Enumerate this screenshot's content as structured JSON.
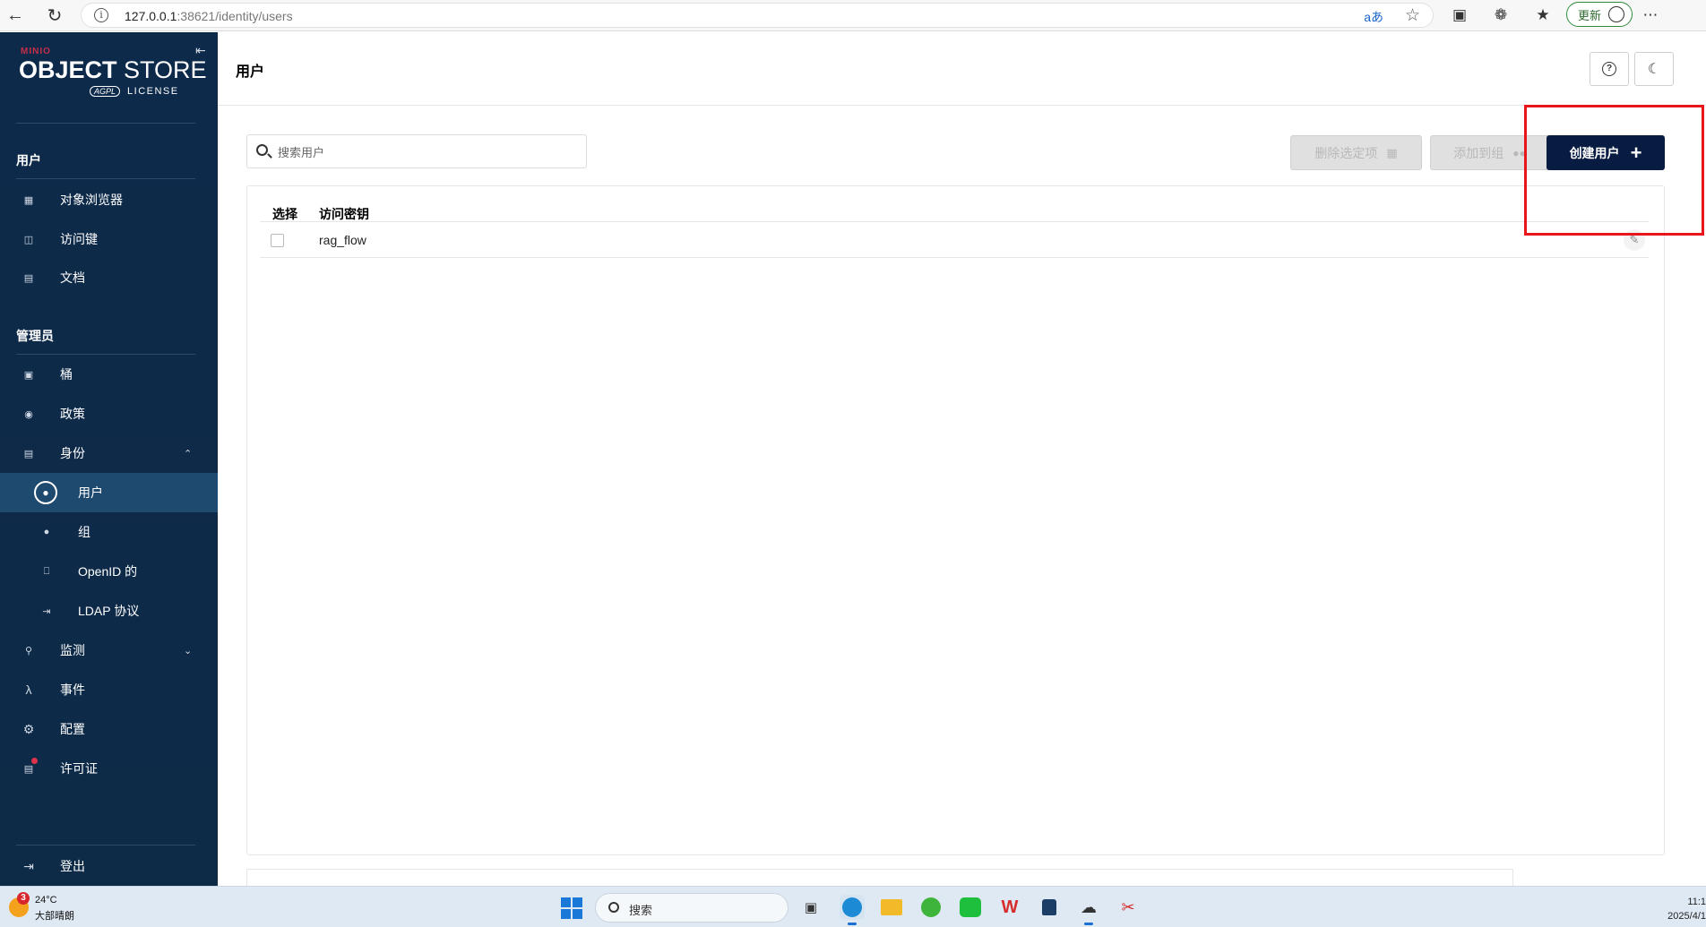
{
  "browser": {
    "url_host": "127.0.0.1",
    "url_rest": ":38621/identity/users",
    "read_aloud": "aあ",
    "update_label": "更新"
  },
  "sidebar": {
    "logo_mini": "MINIO",
    "logo_bold": "OBJECT",
    "logo_light": " STORE",
    "logo_agpl": "AGPL",
    "logo_license": "LICENSE",
    "section_user": "用户",
    "user_items": [
      {
        "label": "对象浏览器",
        "icon": "object-browser-icon"
      },
      {
        "label": "访问键",
        "icon": "access-keys-icon"
      },
      {
        "label": "文档",
        "icon": "documentation-icon"
      }
    ],
    "section_admin": "管理员",
    "admin_items": [
      {
        "label": "桶",
        "icon": "bucket-icon"
      },
      {
        "label": "政策",
        "icon": "policy-icon"
      },
      {
        "label": "身份",
        "icon": "identity-icon"
      }
    ],
    "identity_sub": [
      {
        "label": "用户",
        "icon": "user-icon",
        "active": true
      },
      {
        "label": "组",
        "icon": "group-icon"
      },
      {
        "label": "OpenID 的",
        "icon": "openid-icon"
      },
      {
        "label": "LDAP 协议",
        "icon": "ldap-icon"
      }
    ],
    "more_items": [
      {
        "label": "监测",
        "icon": "monitoring-icon"
      },
      {
        "label": "事件",
        "icon": "events-icon"
      },
      {
        "label": "配置",
        "icon": "configuration-icon"
      },
      {
        "label": "许可证",
        "icon": "license-icon"
      }
    ],
    "logout": "登出"
  },
  "header": {
    "title": "用户"
  },
  "toolbar": {
    "search_placeholder": "搜索用户",
    "delete_selected": "删除选定项",
    "add_to_group": "添加到组",
    "create_user": "创建用户"
  },
  "table": {
    "columns": [
      "选择",
      "访问密钥"
    ],
    "rows": [
      {
        "access_key": "rag_flow",
        "selected": false
      }
    ]
  },
  "taskbar": {
    "weather_badge": "3",
    "temperature": "24°C",
    "condition": "大部晴朗",
    "search_label": "搜索",
    "time": "11:1",
    "date": "2025/4/1"
  },
  "colors": {
    "sidebar_bg": "#0e2a4a",
    "primary_button": "#081c42",
    "highlight_box": "#e8151b"
  }
}
